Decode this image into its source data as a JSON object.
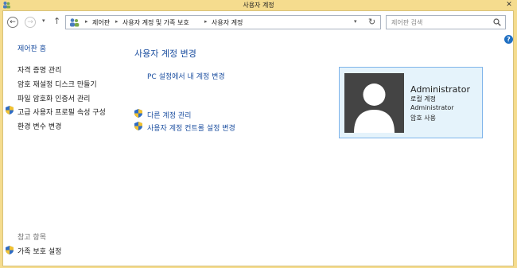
{
  "window": {
    "title": "사용자 계정"
  },
  "navigation": {
    "back": "←",
    "forward": "→",
    "recent": "▾",
    "up": "↑"
  },
  "address": {
    "crumbs": [
      "제어판",
      "사용자 계정 및 가족 보호",
      "사용자 계정"
    ],
    "separator": "▸",
    "dropdown": "▾",
    "refresh": "↻"
  },
  "search": {
    "placeholder": "제어판 검색"
  },
  "help": "?",
  "sidebar": {
    "home": "제어판 홈",
    "items": [
      "자격 증명 관리",
      "암호 재설정 디스크 만들기",
      "파일 암호화 인증서 관리",
      "고급 사용자 프로필 속성 구성",
      "환경 변수 변경"
    ],
    "see_also_title": "참고 항목",
    "see_also_items": [
      "가족 보호 설정"
    ]
  },
  "main": {
    "heading": "사용자 계정 변경",
    "pc_settings_link": "PC 설정에서 내 계정 변경",
    "links": [
      "다른 계정 관리",
      "사용자 계정 컨트롤 설정 변경"
    ]
  },
  "account": {
    "name": "Administrator",
    "type": "로컬 계정",
    "username": "Administrator",
    "password_status": "암호 사용"
  },
  "colors": {
    "title_bar": "#f5dc8e",
    "link": "#1c4fa0",
    "card_background": "#e5f3fb",
    "card_border": "#7eb4ea"
  }
}
